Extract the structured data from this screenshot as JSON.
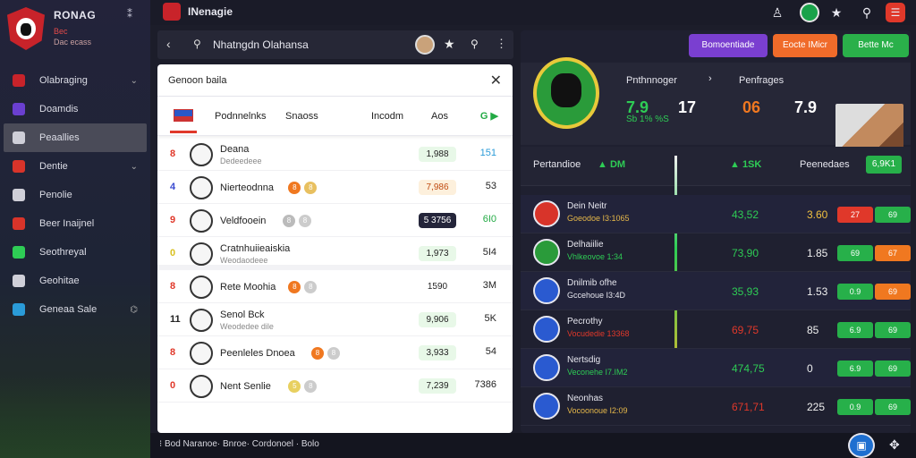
{
  "brand": {
    "title": "RONAG",
    "sub1": "Bec",
    "sub2": "Dac ecass",
    "close": "⁑"
  },
  "sidebar": {
    "items": [
      {
        "label": "Olabraging",
        "icon": "shield-icon",
        "color": "#c8232a",
        "chevron": "⌄"
      },
      {
        "label": "Doamdis",
        "icon": "grid-icon",
        "color": "#6a3fd0",
        "chevron": ""
      },
      {
        "label": "Peaallies",
        "icon": "card-icon",
        "color": "#cfcfd8",
        "chevron": "",
        "active": true
      },
      {
        "label": "Dentie",
        "icon": "globe-icon",
        "color": "#d8342a",
        "chevron": "⌄"
      },
      {
        "label": "Penolie",
        "icon": "settings-icon",
        "color": "#cfcfd8",
        "chevron": ""
      },
      {
        "label": "Beer Inaijnel",
        "icon": "badge-icon",
        "color": "#d8342a",
        "chevron": ""
      },
      {
        "label": "Seothreyal",
        "icon": "chart-icon",
        "color": "#2ecc55",
        "chevron": ""
      },
      {
        "label": "Geohitae",
        "icon": "screen-icon",
        "color": "#cfcfd8",
        "chevron": ""
      },
      {
        "label": "Geneaa Sale",
        "icon": "cloud-icon",
        "color": "#2a9bd8",
        "chevron": "⌬"
      }
    ]
  },
  "topbar": {
    "title": "INenagie"
  },
  "search": {
    "title": "Nhatngdn Olahansa"
  },
  "panel": {
    "title": "Genoon baila",
    "tabs": [
      "Podnnelnks",
      "Snaoss",
      "Incodm",
      "Aos",
      "G ▶"
    ],
    "rows": [
      {
        "num": "8",
        "num_color": "#e0382a",
        "name": "Deana",
        "sub": "Dedeedeee",
        "chips": [],
        "pill": "1,988",
        "pill_bg": "#e8f8e8",
        "pill_fg": "#222",
        "value": "151",
        "value_color": "#2a9bd8",
        "sep": false
      },
      {
        "num": "4",
        "num_color": "#3a4ad0",
        "name": "Nierteodnna",
        "sub": "",
        "chips": [
          {
            "t": "8",
            "c": "#f07820"
          },
          {
            "t": "8",
            "c": "#e8c060"
          }
        ],
        "pill": "7,986",
        "pill_bg": "#fdf0dc",
        "pill_fg": "#c04a10",
        "value": "53",
        "value_color": "#222",
        "sep": false
      },
      {
        "num": "9",
        "num_color": "#e0382a",
        "name": "Veldfooein",
        "sub": "",
        "chips": [
          {
            "t": "8",
            "c": "#bbbbbb"
          },
          {
            "t": "8",
            "c": "#cccccc"
          }
        ],
        "pill": "5 3756",
        "pill_bg": "#24253a",
        "pill_fg": "#fff",
        "value": "6I0",
        "value_color": "#22aa44",
        "sep": false
      },
      {
        "num": "0",
        "num_color": "#d8c020",
        "name": "Cratnhuiieaiskia",
        "sub": "Weodaodeee",
        "chips": [],
        "pill": "1,973",
        "pill_bg": "#e8f8e8",
        "pill_fg": "#222",
        "value": "5I4",
        "value_color": "#222",
        "sep": true
      },
      {
        "num": "8",
        "num_color": "#e0382a",
        "name": "Rete Moohia",
        "sub": "",
        "chips": [
          {
            "t": "8",
            "c": "#f07820"
          },
          {
            "t": "8",
            "c": "#cccccc"
          }
        ],
        "pill": "1590",
        "pill_bg": "#ffffff",
        "pill_fg": "#222",
        "value": "3M",
        "value_color": "#222",
        "sep": false
      },
      {
        "num": "11",
        "num_color": "#222",
        "name": "Senol Bck",
        "sub": "Weodedee dile",
        "chips": [],
        "pill": "9,906",
        "pill_bg": "#e8f8e8",
        "pill_fg": "#222",
        "value": "5K",
        "value_color": "#222",
        "sep": false
      },
      {
        "num": "8",
        "num_color": "#e0382a",
        "name": "Peenleles Dnoea",
        "sub": "",
        "chips": [
          {
            "t": "8",
            "c": "#f07820"
          },
          {
            "t": "8",
            "c": "#cccccc"
          }
        ],
        "pill": "3,933",
        "pill_bg": "#e8f8e8",
        "pill_fg": "#222",
        "value": "54",
        "value_color": "#222",
        "sep": false
      },
      {
        "num": "0",
        "num_color": "#e0382a",
        "name": "Nent Senlie",
        "sub": "",
        "chips": [
          {
            "t": "5",
            "c": "#e8d060"
          },
          {
            "t": "8",
            "c": "#cccccc"
          }
        ],
        "pill": "7,239",
        "pill_bg": "#e8f8e8",
        "pill_fg": "#222",
        "value": "7386",
        "value_color": "#222",
        "sep": false
      }
    ]
  },
  "dash": {
    "buttons": [
      {
        "label": "Bomoentiade",
        "bg": "#7a3fd0"
      },
      {
        "label": "Eocte IMicr",
        "bg": "#f06b2a"
      },
      {
        "label": "Bette Mc",
        "bg": "#2ab04a"
      }
    ],
    "hero": {
      "col1_title": "Pnthnnoger",
      "col1_big_a": "7.9",
      "col1_big_b": "17",
      "col1_small": "Sb 1% %S",
      "col2_title": "Penfrages",
      "col2_big_a": "06",
      "col2_big_b": "7.9",
      "chevron": "›"
    },
    "stats": {
      "label": "Pertandioe",
      "green1": "▲ DM",
      "green2": "▲ 1SK",
      "label2": "Peenedaes",
      "pill": "6,9K1"
    },
    "rows": [
      {
        "name": "Dein Neitr",
        "sub": "Goeodoe I3:1065",
        "sub_color": "#e6b84a",
        "crest": "#d8342a",
        "v1": "43,52",
        "v1_color": "#2ecc55",
        "v2": "3.60",
        "v2_color": "#f0c040",
        "p1": "27",
        "p1_bg": "#e0382a",
        "p2": "69",
        "p2_bg": "#27b04a"
      },
      {
        "name": "Delhaiilie",
        "sub": "Vhlkeovoe 1:34",
        "sub_color": "#2ecc55",
        "crest": "#2a9b3a",
        "v1": "73,90",
        "v1_color": "#2ecc55",
        "v2": "1.85",
        "v2_color": "#f0f0f0",
        "p1": "69",
        "p1_bg": "#27b04a",
        "p2": "67",
        "p2_bg": "#f07820"
      },
      {
        "name": "Dnilmib ofhe",
        "sub": "Gccehoue I3:4D",
        "sub_color": "#e6e6ee",
        "crest": "#2a5ad0",
        "v1": "35,93",
        "v1_color": "#2ecc55",
        "v2": "1.53",
        "v2_color": "#f0f0f0",
        "p1": "0.9",
        "p1_bg": "#27b04a",
        "p2": "69",
        "p2_bg": "#f07820"
      },
      {
        "name": "Pecrothy",
        "sub": "Vocudedie 13368",
        "sub_color": "#e0382a",
        "crest": "#2a5ad0",
        "v1": "69,75",
        "v1_color": "#e0382a",
        "v2": "85",
        "v2_color": "#f0f0f0",
        "p1": "6.9",
        "p1_bg": "#27b04a",
        "p2": "69",
        "p2_bg": "#27b04a"
      },
      {
        "name": "Nertsdig",
        "sub": "Veconehe I7.IM2",
        "sub_color": "#2ecc55",
        "crest": "#2a5ad0",
        "v1": "474,75",
        "v1_color": "#2ecc55",
        "v2": "0",
        "v2_color": "#f0f0f0",
        "p1": "6.9",
        "p1_bg": "#27b04a",
        "p2": "69",
        "p2_bg": "#27b04a"
      },
      {
        "name": "Neonhas",
        "sub": "Vocoonoue I2:09",
        "sub_color": "#e6b84a",
        "crest": "#2a5ad0",
        "v1": "671,71",
        "v1_color": "#e0382a",
        "v2": "225",
        "v2_color": "#f0f0f0",
        "p1": "0.9",
        "p1_bg": "#27b04a",
        "p2": "69",
        "p2_bg": "#27b04a"
      }
    ]
  },
  "bottombar": {
    "text": "⁝ Bod  Naranoe·  Bnroe·  Cordonoel ·  Bolo"
  }
}
